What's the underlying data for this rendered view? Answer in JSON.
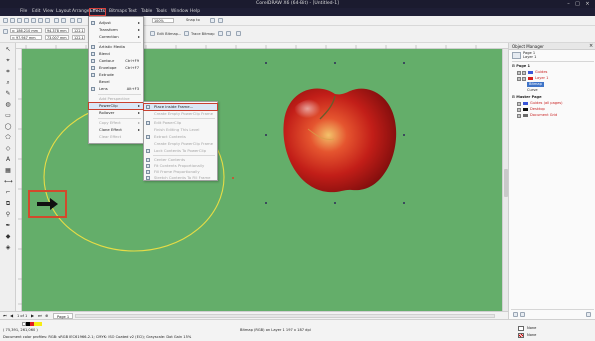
{
  "window": {
    "title": "CorelDRAW X6 (64-Bit) - [Untitled-1]",
    "controls": [
      "–",
      "□",
      "×"
    ]
  },
  "menubar": {
    "items": [
      "File",
      "Edit",
      "View",
      "Layout",
      "Arrange",
      "Effects",
      "Bitmaps",
      "Text",
      "Table",
      "Tools",
      "Window",
      "Help"
    ],
    "active": "Effects"
  },
  "toolbar": {
    "zoom": "100%",
    "snap_to": "Snap to",
    "edit_bitmap": "Edit Bitmap...",
    "trace_bitmap": "Trace Bitmap"
  },
  "property_bar": {
    "x": "x: 186.210 mm",
    "y": "y: 97.947 mm",
    "w": "94.378 mm",
    "h": "73.007 mm",
    "scale_w": "122.1",
    "scale_h": "122.1"
  },
  "effects_menu": {
    "items": [
      {
        "label": "Adjust",
        "arrow": true
      },
      {
        "label": "Transform",
        "arrow": true
      },
      {
        "label": "Correction",
        "arrow": true
      },
      {
        "label": "Artistic Media"
      },
      {
        "label": "Blend"
      },
      {
        "label": "Contour",
        "shortcut": "Ctrl+F9"
      },
      {
        "label": "Envelope",
        "shortcut": "Ctrl+F7"
      },
      {
        "label": "Extrude"
      },
      {
        "label": "Bevel"
      },
      {
        "label": "Lens",
        "shortcut": "Alt+F3"
      },
      {
        "label": "Add Perspective"
      },
      {
        "label": "PowerClip",
        "arrow": true
      },
      {
        "label": "Rollover",
        "arrow": true
      },
      {
        "label": "Copy Effect"
      },
      {
        "label": "Clone Effect"
      },
      {
        "label": "Clear Effect"
      }
    ]
  },
  "powerclip_menu": {
    "items": [
      {
        "label": "Place inside Frame...",
        "enabled": true
      },
      {
        "label": "Create Empty PowerClip Frame",
        "enabled": false
      },
      {
        "label": "Edit PowerClip",
        "enabled": false
      },
      {
        "label": "Finish Editing This Level",
        "enabled": false
      },
      {
        "label": "Extract Contents",
        "enabled": false
      },
      {
        "label": "Create Empty PowerClip Frame",
        "enabled": false
      },
      {
        "label": "Lock Contents To PowerClip",
        "enabled": false
      },
      {
        "label": "Center Contents",
        "enabled": false
      },
      {
        "label": "Fit Contents Proportionally",
        "enabled": false
      },
      {
        "label": "Fill Frame Proportionally",
        "enabled": false
      },
      {
        "label": "Stretch Contents To Fill Frame",
        "enabled": false
      }
    ]
  },
  "object_manager": {
    "title": "Object Manager",
    "page_header": "Page 1",
    "layer_header": "Layer 1",
    "rows": [
      {
        "label": "Page 1",
        "level": 0
      },
      {
        "label": "Guides",
        "level": 1
      },
      {
        "label": "Layer 1",
        "level": 1
      },
      {
        "label": "Bitmap",
        "level": 2
      },
      {
        "label": "Curve",
        "level": 2
      },
      {
        "label": "Master Page",
        "level": 0
      },
      {
        "label": "Guides (all pages)",
        "level": 1
      },
      {
        "label": "Desktop",
        "level": 1
      },
      {
        "label": "Document Grid",
        "level": 1
      }
    ]
  },
  "pagebar": {
    "page_count": "1 of 1",
    "tab": "Page 1"
  },
  "status": {
    "coords": "( 75,391, 261,060 )",
    "object": "Bitmap (RGB) on Layer 1 197 x 187 dpi",
    "profiles": "Document color profiles: RGB: sRGB IEC61966-2.1; CMYK: ISO Coated v2 (ECI); Grayscale: Dot Gain 15%",
    "fill_label": "None",
    "outline_label": "None"
  },
  "colors": {
    "canvas": "#64ae6a",
    "circle": "#e6dc46",
    "highlight_box": "#d24a2c",
    "menubar": "#1e1e35"
  }
}
